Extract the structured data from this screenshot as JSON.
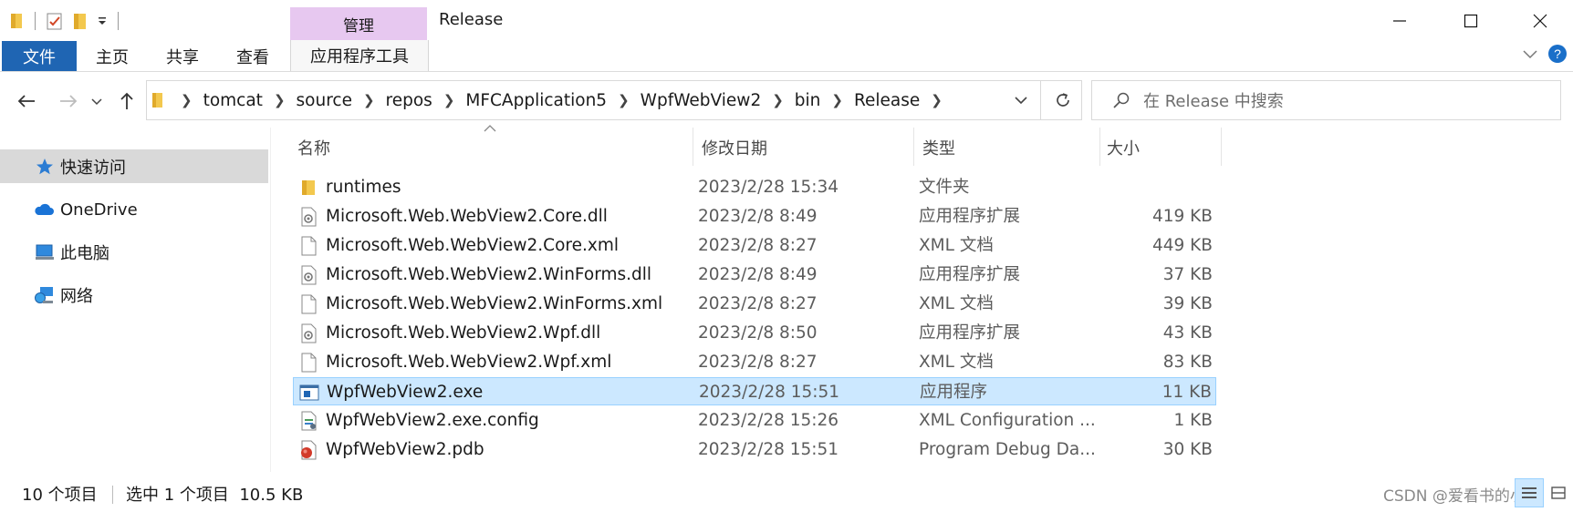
{
  "window": {
    "title": "Release"
  },
  "ribbon": {
    "context_tab": "管理",
    "tabs": [
      "文件",
      "主页",
      "共享",
      "查看"
    ],
    "tools_tab": "应用程序工具"
  },
  "address": {
    "crumbs": [
      "tomcat",
      "source",
      "repos",
      "MFCApplication5",
      "WpfWebView2",
      "bin",
      "Release"
    ]
  },
  "search": {
    "placeholder": "在 Release 中搜索"
  },
  "nav": {
    "items": [
      "快速访问",
      "OneDrive",
      "此电脑",
      "网络"
    ]
  },
  "columns": {
    "name": "名称",
    "date": "修改日期",
    "type": "类型",
    "size": "大小"
  },
  "files": [
    {
      "name": "runtimes",
      "date": "2023/2/28 15:34",
      "type": "文件夹",
      "size": "",
      "icon": "folder-icon"
    },
    {
      "name": "Microsoft.Web.WebView2.Core.dll",
      "date": "2023/2/8 8:49",
      "type": "应用程序扩展",
      "size": "419 KB",
      "icon": "dll-file-icon"
    },
    {
      "name": "Microsoft.Web.WebView2.Core.xml",
      "date": "2023/2/8 8:27",
      "type": "XML 文档",
      "size": "449 KB",
      "icon": "blank-file-icon"
    },
    {
      "name": "Microsoft.Web.WebView2.WinForms.dll",
      "date": "2023/2/8 8:49",
      "type": "应用程序扩展",
      "size": "37 KB",
      "icon": "dll-file-icon"
    },
    {
      "name": "Microsoft.Web.WebView2.WinForms.xml",
      "date": "2023/2/8 8:27",
      "type": "XML 文档",
      "size": "39 KB",
      "icon": "blank-file-icon"
    },
    {
      "name": "Microsoft.Web.WebView2.Wpf.dll",
      "date": "2023/2/8 8:50",
      "type": "应用程序扩展",
      "size": "43 KB",
      "icon": "dll-file-icon"
    },
    {
      "name": "Microsoft.Web.WebView2.Wpf.xml",
      "date": "2023/2/8 8:27",
      "type": "XML 文档",
      "size": "83 KB",
      "icon": "blank-file-icon"
    },
    {
      "name": "WpfWebView2.exe",
      "date": "2023/2/28 15:51",
      "type": "应用程序",
      "size": "11 KB",
      "icon": "exe-file-icon",
      "selected": true
    },
    {
      "name": "WpfWebView2.exe.config",
      "date": "2023/2/28 15:26",
      "type": "XML Configuration ...",
      "size": "1 KB",
      "icon": "config-file-icon"
    },
    {
      "name": "WpfWebView2.pdb",
      "date": "2023/2/28 15:51",
      "type": "Program Debug Da...",
      "size": "30 KB",
      "icon": "pdb-file-icon"
    }
  ],
  "status": {
    "count": "10 个项目",
    "selection": "选中 1 个项目  10.5 KB"
  },
  "watermark": "CSDN @爱看书的小沐",
  "colors": {
    "accent": "#1f65b3",
    "context_tab": "#e7c8f0",
    "selection": "#cce8ff",
    "selection_border": "#99d1ff"
  }
}
